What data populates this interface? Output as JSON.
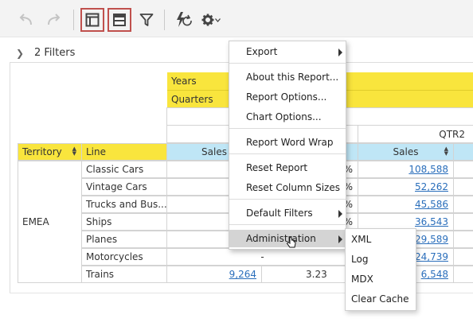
{
  "toolbar": {
    "undo": "undo-icon",
    "redo": "redo-icon",
    "layout_a": "layout-panel-icon",
    "layout_b": "layout-table-icon",
    "filter": "filter-icon",
    "refresh": "auto-refresh-icon",
    "settings": "gear-icon",
    "accent": "#c0504d"
  },
  "filters": {
    "label": "2 Filters"
  },
  "pivot": {
    "years_label": "Years",
    "quarters_label": "Quarters",
    "qtr2_label": "QTR2",
    "territory_header": "Territory",
    "line_header": "Line",
    "sales_header_left": "Sales",
    "sales_header_right": "Sales",
    "territory": "EMEA",
    "rows": [
      {
        "line": "Classic Cars",
        "pct_fragment": "4%",
        "q2_sales": "108,588"
      },
      {
        "line": "Vintage Cars",
        "pct_fragment": "7%",
        "q2_sales": "52,262"
      },
      {
        "line": "Trucks and Bus...",
        "pct_fragment": "1%",
        "q2_sales": "45,586"
      },
      {
        "line": "Ships",
        "pct_fragment": "1%",
        "q2_sales": "36,543"
      },
      {
        "line": "Planes",
        "pct_fragment": "",
        "q2_sales": "29,589"
      },
      {
        "line": "Motorcycles",
        "left_value": "-",
        "q2_sales": "24,739"
      },
      {
        "line": "Trains",
        "left_value": "9,264",
        "mid_value": "3.23",
        "q2_sales": "6,548"
      }
    ],
    "colors": {
      "header_yellow": "#f9e53d",
      "header_blue": "#bfe6f6",
      "link": "#2a6ebb"
    }
  },
  "menu": {
    "export": "Export",
    "about": "About this Report...",
    "report_options": "Report Options...",
    "chart_options": "Chart Options...",
    "word_wrap": "Report Word Wrap",
    "reset_report": "Reset Report",
    "reset_columns": "Reset Column Sizes",
    "default_filters": "Default Filters",
    "administration": "Administration"
  },
  "submenu": {
    "xml": "XML",
    "log": "Log",
    "mdx": "MDX",
    "clear_cache": "Clear Cache"
  }
}
